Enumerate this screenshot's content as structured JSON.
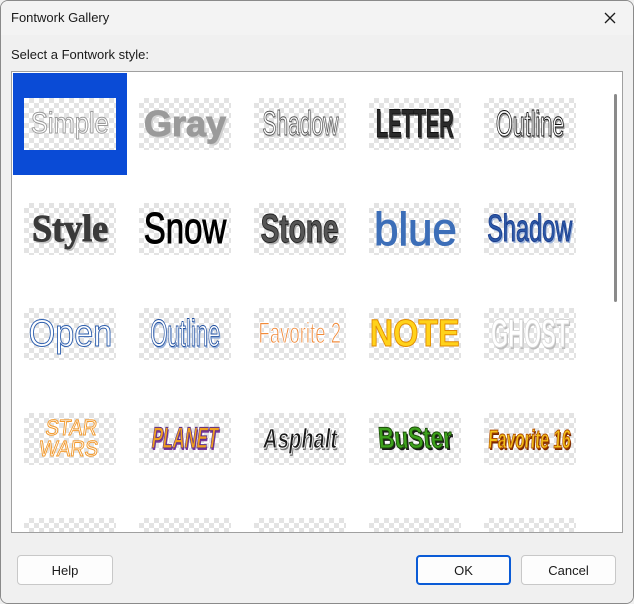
{
  "window": {
    "title": "Fontwork Gallery",
    "close_icon": "close-icon"
  },
  "prompt": "Select a Fontwork style:",
  "gallery": {
    "selected_index": 0,
    "items": [
      {
        "label": "Simple",
        "fill": "#ffffff",
        "stroke": "#9a9a9a",
        "shadow": "none",
        "font": "sans",
        "weight": "normal",
        "size": 30,
        "stretch": 0.85,
        "skew": 0
      },
      {
        "label": "Gray",
        "fill": "#9a9a9a",
        "stroke": "#9a9a9a",
        "shadow": "#d0d0d0",
        "font": "sans",
        "weight": "bold",
        "size": 36,
        "stretch": 1.0,
        "skew": 0
      },
      {
        "label": "Shadow",
        "fill": "#ffffff",
        "stroke": "#555555",
        "shadow": "#cfcfcf",
        "font": "sans",
        "weight": "normal",
        "size": 34,
        "stretch": 0.62,
        "skew": 0
      },
      {
        "label": "LETTER",
        "fill": "#2a2a2a",
        "stroke": "#111111",
        "shadow": "#7a7a7a",
        "font": "sans",
        "weight": "bold",
        "size": 40,
        "stretch": 0.5,
        "skew": 0
      },
      {
        "label": "Outline",
        "fill": "#ffffff",
        "stroke": "#111111",
        "shadow": "#999999",
        "font": "sans",
        "weight": "normal",
        "size": 36,
        "stretch": 0.6,
        "skew": 0
      },
      {
        "label": "Style",
        "fill": "#3a3a3a",
        "stroke": "#3a3a3a",
        "shadow": "#c0c0c0",
        "font": "serif",
        "weight": "bold",
        "size": 38,
        "stretch": 0.95,
        "skew": 0
      },
      {
        "label": "Snow",
        "fill": "#000000",
        "stroke": "#000000",
        "shadow": "#ffffff",
        "font": "sans",
        "weight": "normal",
        "size": 44,
        "stretch": 0.75,
        "skew": 0
      },
      {
        "label": "Stone",
        "fill": "#555555",
        "stroke": "#222222",
        "shadow": "#aaaaaa",
        "font": "sans",
        "weight": "bold",
        "size": 40,
        "stretch": 0.7,
        "skew": 0
      },
      {
        "label": "blue",
        "fill": "#3c6eb8",
        "stroke": "#3c6eb8",
        "shadow": "none",
        "font": "sans",
        "weight": "normal",
        "size": 46,
        "stretch": 0.95,
        "skew": 0
      },
      {
        "label": "Shadow",
        "fill": "#2c5aa8",
        "stroke": "#1a3a8a",
        "shadow": "#9bb3da",
        "font": "sans",
        "weight": "normal",
        "size": 38,
        "stretch": 0.62,
        "skew": 0
      },
      {
        "label": "Open",
        "fill": "#ffffff",
        "stroke": "#2e5fae",
        "shadow": "none",
        "font": "sans",
        "weight": "normal",
        "size": 38,
        "stretch": 0.9,
        "skew": 0
      },
      {
        "label": "Outline",
        "fill": "#ffffff",
        "stroke": "#1f4fa0",
        "shadow": "#9bb3da",
        "font": "sans",
        "weight": "normal",
        "size": 38,
        "stretch": 0.58,
        "skew": 0
      },
      {
        "label": "Favorite 2",
        "fill": "#f08a3a",
        "stroke": "#ffffff",
        "shadow": "none",
        "font": "sans",
        "weight": "normal",
        "size": 30,
        "stretch": 0.62,
        "skew": 0
      },
      {
        "label": "NOTE",
        "fill": "#ffd21a",
        "stroke": "#e08a00",
        "shadow": "none",
        "font": "sans",
        "weight": "bold",
        "size": 38,
        "stretch": 0.85,
        "skew": 0
      },
      {
        "label": "GHOST",
        "fill": "#ffffff",
        "stroke": "#d8d8d8",
        "shadow": "#bdbdbd",
        "font": "sans",
        "weight": "bold",
        "size": 40,
        "stretch": 0.55,
        "skew": 0
      },
      {
        "label": "STAR WARS",
        "fill": "#ffffff",
        "stroke": "#f29a2e",
        "shadow": "none",
        "font": "sans",
        "weight": "normal",
        "size": 22,
        "stretch": 0.9,
        "skew": -8
      },
      {
        "label": "PLANET",
        "fill": "#f0a020",
        "stroke": "#5a2a8a",
        "shadow": "#7a3a9a",
        "font": "sans",
        "weight": "bold",
        "size": 30,
        "stretch": 0.55,
        "skew": -14
      },
      {
        "label": "Asphalt",
        "fill": "#1a1a1a",
        "stroke": "#ffffff",
        "shadow": "#777777",
        "font": "sans",
        "weight": "bold",
        "size": 28,
        "stretch": 0.72,
        "skew": -10
      },
      {
        "label": "BuSter",
        "fill": "#3da11c",
        "stroke": "#1a4a08",
        "shadow": "#1a1a1a",
        "font": "sans",
        "weight": "bold",
        "size": 30,
        "stretch": 0.75,
        "skew": 6
      },
      {
        "label": "Favorite 16",
        "fill": "#f2c21a",
        "stroke": "#b04a00",
        "shadow": "#7a2a00",
        "font": "sans",
        "weight": "bold",
        "size": 26,
        "stretch": 0.6,
        "skew": -6
      },
      {
        "label": "",
        "fill": "#d01818",
        "stroke": "#8a0000",
        "shadow": "none",
        "font": "sans",
        "weight": "bold",
        "size": 30,
        "stretch": 0.7,
        "skew": 0
      },
      {
        "label": "",
        "fill": "#2a9aa8",
        "stroke": "#0a3a48",
        "shadow": "none",
        "font": "sans",
        "weight": "bold",
        "size": 30,
        "stretch": 0.7,
        "skew": 0
      },
      {
        "label": "",
        "fill": "#3a8ae8",
        "stroke": "#ffffff",
        "shadow": "#d04040",
        "font": "sans",
        "weight": "bold",
        "size": 30,
        "stretch": 0.7,
        "skew": 0
      },
      {
        "label": "",
        "fill": "#ffffff",
        "stroke": "#333333",
        "shadow": "none",
        "font": "sans",
        "weight": "bold",
        "size": 30,
        "stretch": 0.6,
        "skew": 0
      },
      {
        "label": "",
        "fill": "#c81818",
        "stroke": "#ffffff",
        "shadow": "#2a4ab0",
        "font": "sans",
        "weight": "bold",
        "size": 30,
        "stretch": 0.7,
        "skew": 0
      }
    ]
  },
  "buttons": {
    "help": "Help",
    "ok": "OK",
    "cancel": "Cancel"
  },
  "colors": {
    "selection": "#0a4bd6",
    "primary_border": "#0a5bd6"
  }
}
